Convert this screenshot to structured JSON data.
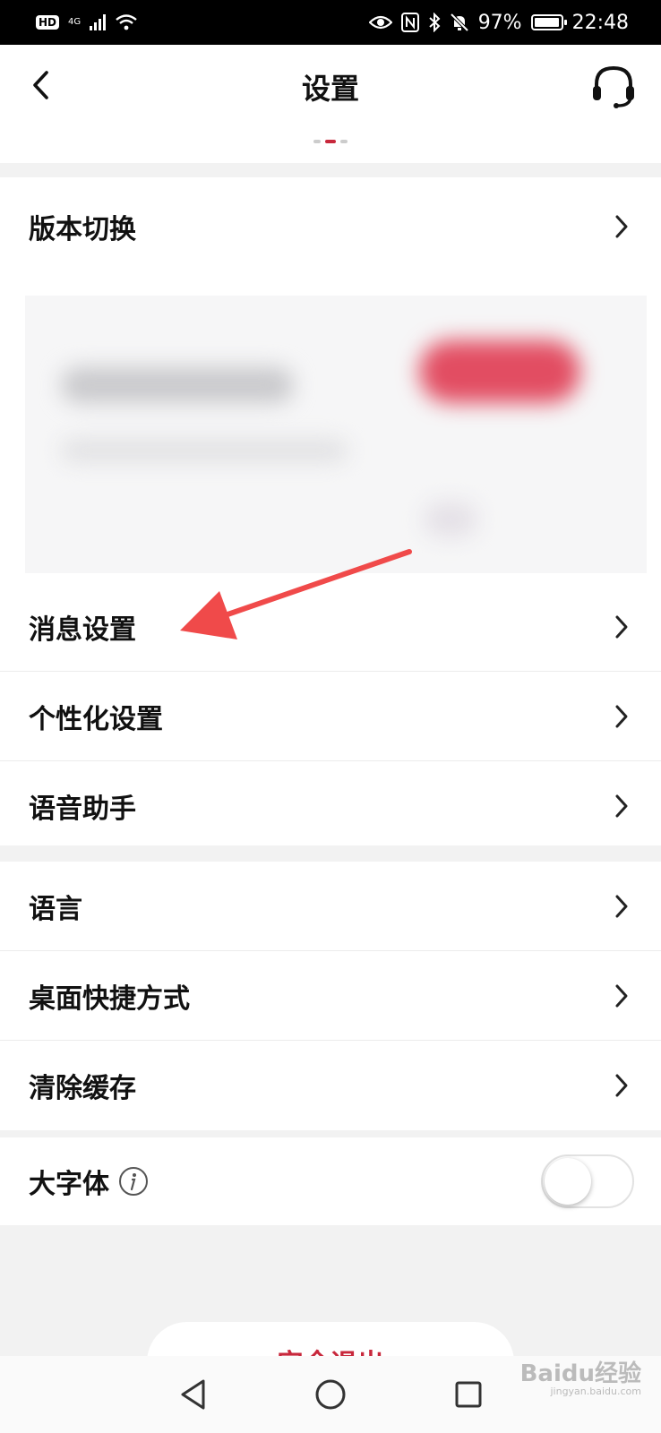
{
  "status_bar": {
    "hd": "HD",
    "network": "4G",
    "battery": "97%",
    "time": "22:48"
  },
  "header": {
    "title": "设置"
  },
  "section1": {
    "items": [
      {
        "label": "版本切换"
      },
      {
        "label": "消息设置"
      },
      {
        "label": "个性化设置"
      },
      {
        "label": "语音助手"
      }
    ]
  },
  "section2": {
    "items": [
      {
        "label": "语言"
      },
      {
        "label": "桌面快捷方式"
      },
      {
        "label": "清除缓存"
      }
    ]
  },
  "section3": {
    "large_font": {
      "label": "大字体",
      "enabled": false
    }
  },
  "logout": {
    "label": "安全退出"
  },
  "watermark": {
    "brand": "Baidu经验",
    "url": "jingyan.baidu.com"
  },
  "colors": {
    "accent": "#c8283c",
    "annotation_arrow": "#f04a4a"
  }
}
